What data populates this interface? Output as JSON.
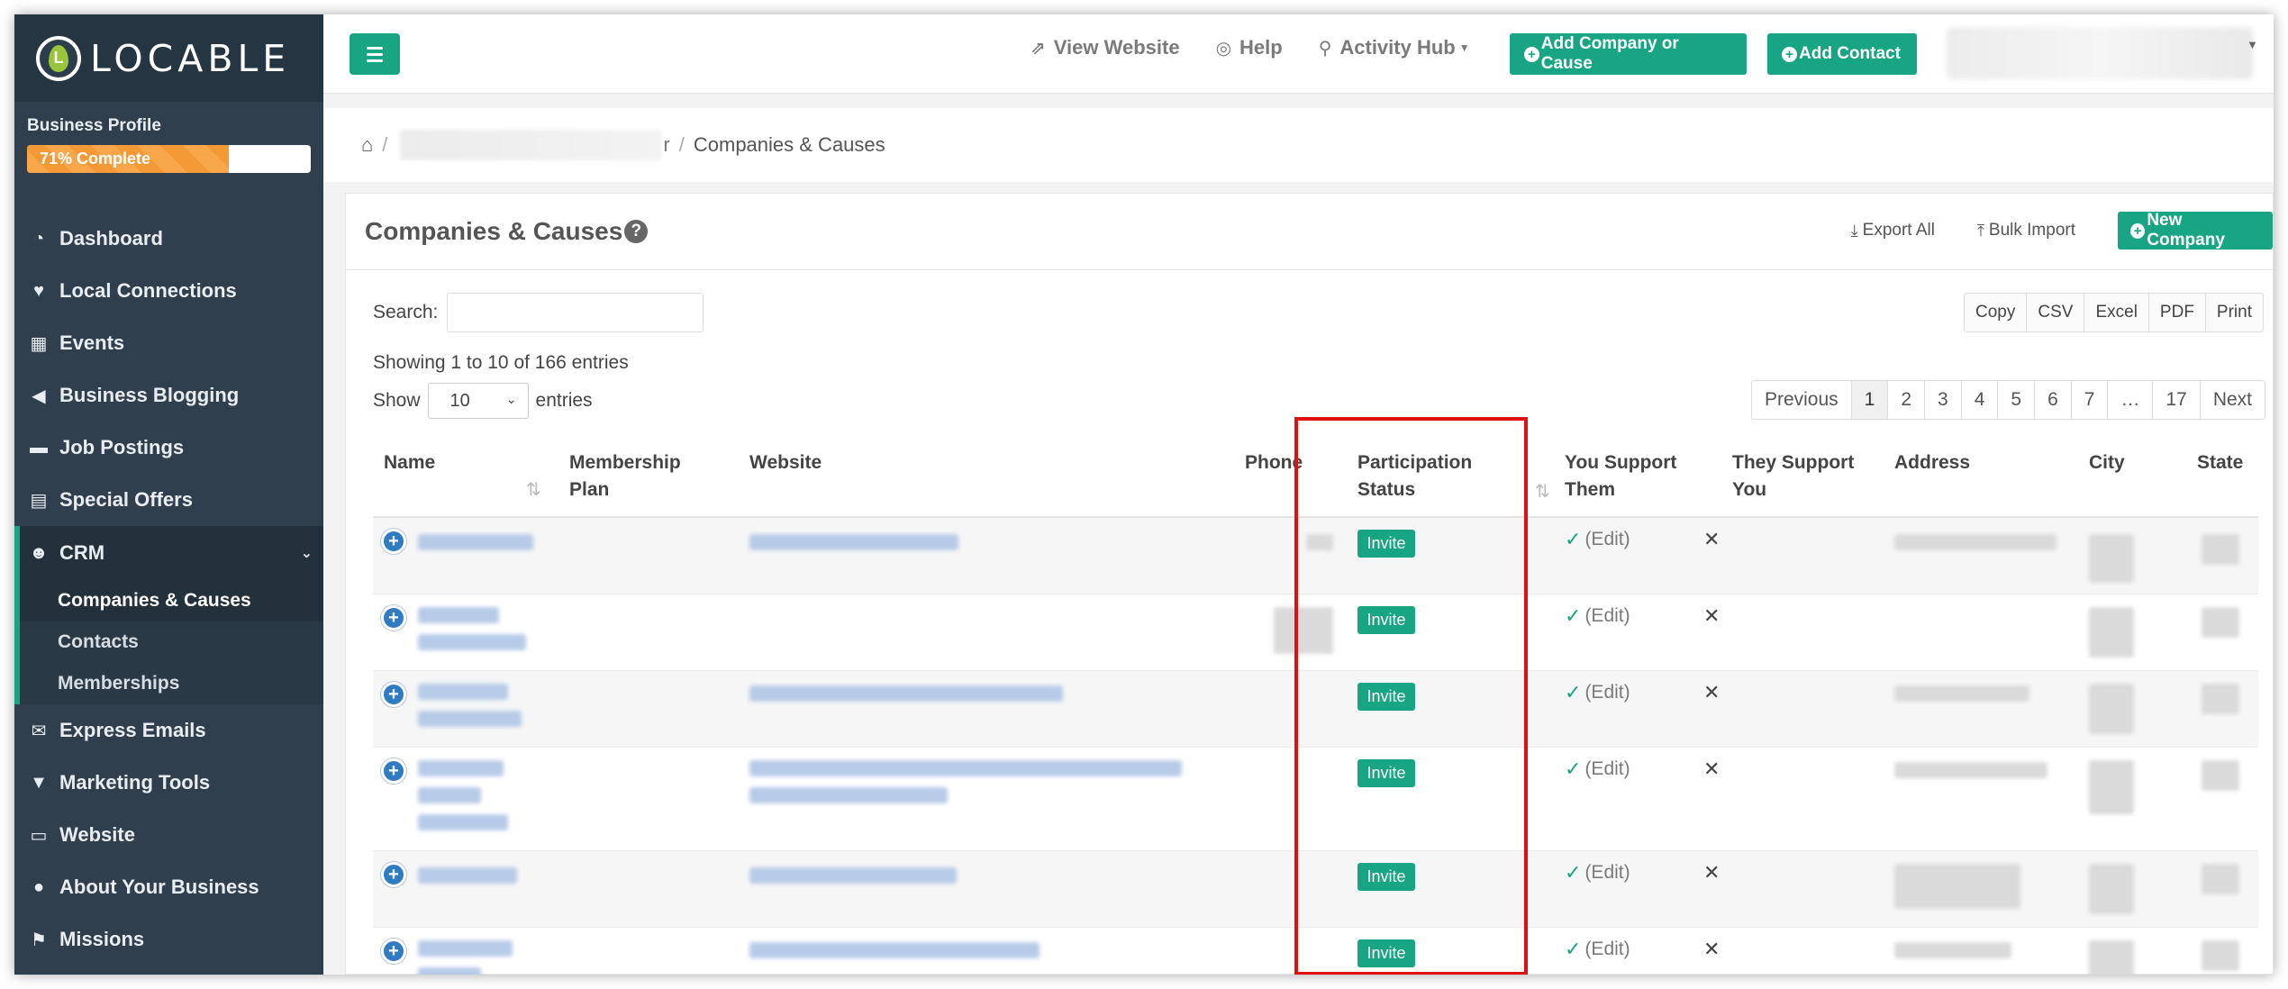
{
  "logo": {
    "letter": "L",
    "text": "LOCABLE"
  },
  "profile": {
    "label": "Business Profile",
    "progress_text": "71% Complete",
    "progress_pct": 71
  },
  "nav": {
    "dashboard": "Dashboard",
    "local_connections": "Local Connections",
    "events": "Events",
    "business_blogging": "Business Blogging",
    "job_postings": "Job Postings",
    "special_offers": "Special Offers",
    "crm": "CRM",
    "crm_sub": [
      "Companies & Causes",
      "Contacts",
      "Memberships"
    ],
    "express_emails": "Express Emails",
    "marketing_tools": "Marketing Tools",
    "website": "Website",
    "about_your_business": "About Your Business",
    "missions": "Missions"
  },
  "topbar": {
    "view_website": "View Website",
    "help": "Help",
    "activity_hub": "Activity Hub",
    "add_company": "Add Company or Cause",
    "add_contact": "Add Contact"
  },
  "breadcrumb": {
    "partial": "r",
    "current": "Companies & Causes"
  },
  "panel": {
    "title": "Companies & Causes",
    "export_all": "Export All",
    "bulk_import": "Bulk Import",
    "new_company": "New Company"
  },
  "search": {
    "label": "Search:",
    "value": ""
  },
  "export_buttons": [
    "Copy",
    "CSV",
    "Excel",
    "PDF",
    "Print"
  ],
  "info": "Showing 1 to 10 of 166 entries",
  "length": {
    "show": "Show",
    "value": "10",
    "entries": "entries"
  },
  "pager": [
    "Previous",
    "1",
    "2",
    "3",
    "4",
    "5",
    "6",
    "7",
    "…",
    "17",
    "Next"
  ],
  "columns": {
    "name": "Name",
    "membership_1": "Membership",
    "membership_2": "Plan",
    "website": "Website",
    "phone": "Phone",
    "participation_1": "Participation",
    "participation_2": "Status",
    "you_support_1": "You Support",
    "you_support_2": "Them",
    "they_support_1": "They Support",
    "they_support_2": "You",
    "address": "Address",
    "city": "City",
    "state": "State"
  },
  "rows": [
    {
      "status": "Invite",
      "support": "(Edit)"
    },
    {
      "status": "Invite",
      "support": "(Edit)"
    },
    {
      "status": "Invite",
      "support": "(Edit)"
    },
    {
      "status": "Invite",
      "support": "(Edit)"
    },
    {
      "status": "Invite",
      "support": "(Edit)"
    },
    {
      "status": "Invite",
      "support": "(Edit)"
    }
  ],
  "colors": {
    "brand_green": "#17a583",
    "sidebar": "#2f3f4e",
    "highlight_red": "#e01010",
    "progress_orange": "#f39a36"
  }
}
